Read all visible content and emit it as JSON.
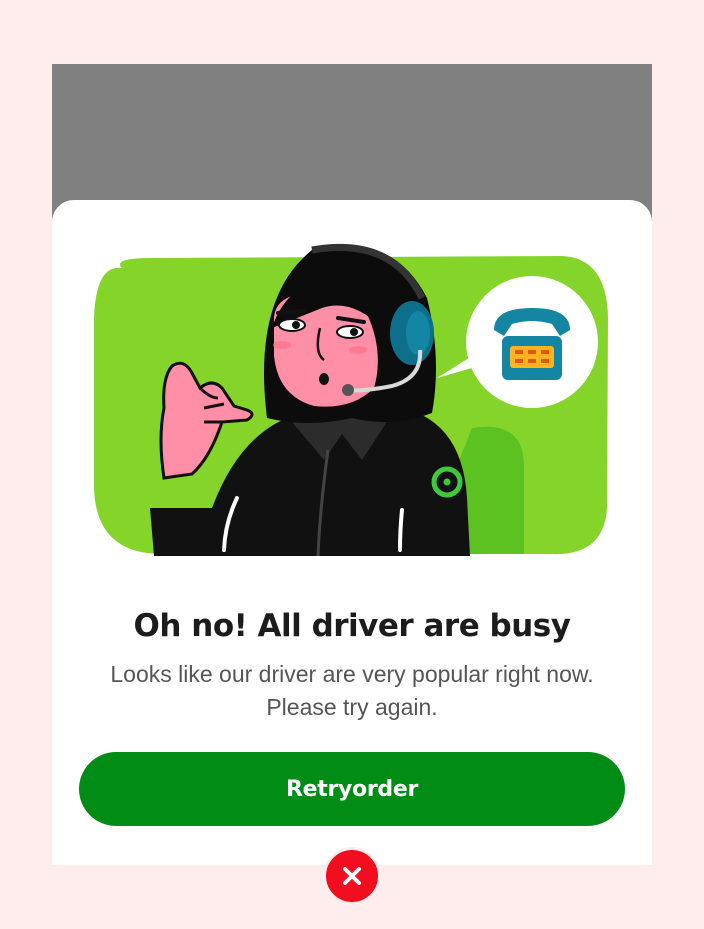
{
  "dialog": {
    "title": "Oh no! All driver are busy",
    "message": "Looks like our driver are very popular right now. Please try again.",
    "retry_label": "Retryorder"
  },
  "illustration": {
    "subject": "call-center-agent",
    "bubble_icon": "telephone-icon",
    "logo_icon": "brand-logo-icon"
  },
  "colors": {
    "accent": "#008c15",
    "illustration_bg": "#85d42a",
    "close": "#f20d1f",
    "page_bg": "#ffecec",
    "backdrop": "#808080"
  },
  "close": {
    "icon": "close-icon"
  }
}
